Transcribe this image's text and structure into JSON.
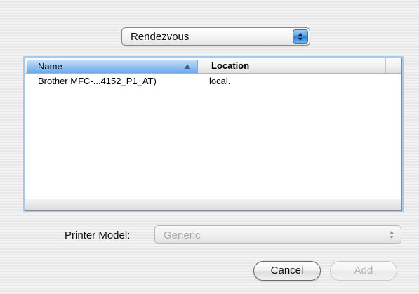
{
  "source_popup": {
    "selected": "Rendezvous"
  },
  "printer_list": {
    "columns": {
      "name": "Name",
      "location": "Location"
    },
    "sort_direction": "ascending",
    "rows": [
      {
        "name": "Brother MFC-...4152_P1_AT)",
        "location": "local."
      }
    ]
  },
  "printer_model": {
    "label": "Printer Model:",
    "selected": "Generic"
  },
  "buttons": {
    "cancel": "Cancel",
    "add": "Add"
  },
  "colors": {
    "selected_header": "#92c1f2",
    "popup_arrow_blue": "#4f9ee8",
    "disabled_text": "#b3b3b3"
  }
}
